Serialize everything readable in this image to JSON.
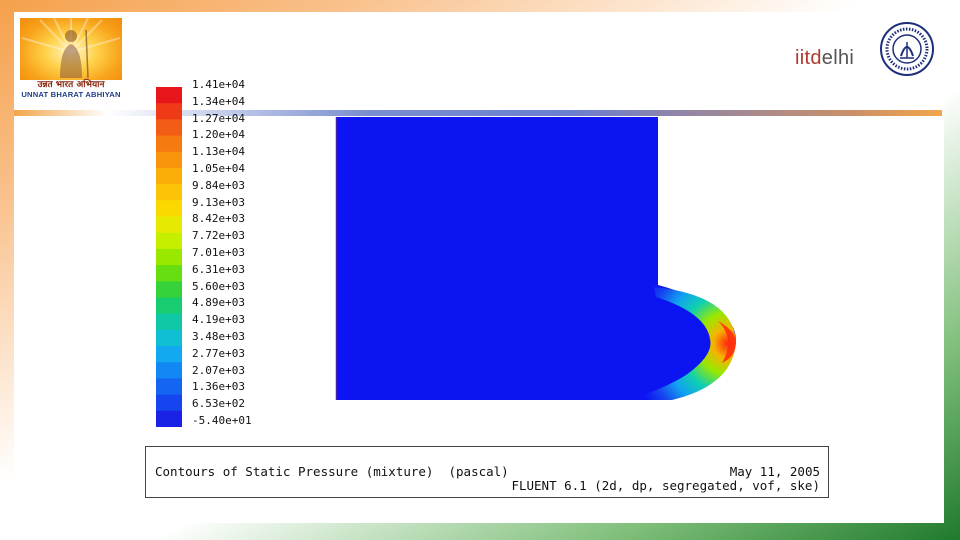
{
  "branding": {
    "uba_hindi": "उन्नत भारत अभियान",
    "uba_english": "UNNAT BHARAT ABHIYAN",
    "iitd_part_a": "iitd",
    "iitd_part_b": "elhi"
  },
  "colorbar": {
    "labels": [
      "1.41e+04",
      "1.34e+04",
      "1.27e+04",
      "1.20e+04",
      "1.13e+04",
      "1.05e+04",
      "9.84e+03",
      "9.13e+03",
      "8.42e+03",
      "7.72e+03",
      "7.01e+03",
      "6.31e+03",
      "5.60e+03",
      "4.89e+03",
      "4.19e+03",
      "3.48e+03",
      "2.77e+03",
      "2.07e+03",
      "1.36e+03",
      "6.53e+02",
      "-5.40e+01"
    ],
    "colors": [
      "#e8151a",
      "#ee3a17",
      "#f25c14",
      "#f57a10",
      "#f8950c",
      "#fbae08",
      "#fdc405",
      "#fbd900",
      "#e6ea00",
      "#c6ef00",
      "#9ae800",
      "#66de10",
      "#35d23a",
      "#18cc70",
      "#10c8a6",
      "#10bfd4",
      "#12a9f0",
      "#1288f4",
      "#1466f2",
      "#1644ee",
      "#1a22e6"
    ]
  },
  "plot": {
    "field_color": "#0c14f2"
  },
  "caption": {
    "title": "Contours of Static Pressure (mixture)  (pascal)",
    "date": "May 11, 2005",
    "solver": "FLUENT 6.1 (2d, dp, segregated, vof, ske)"
  }
}
